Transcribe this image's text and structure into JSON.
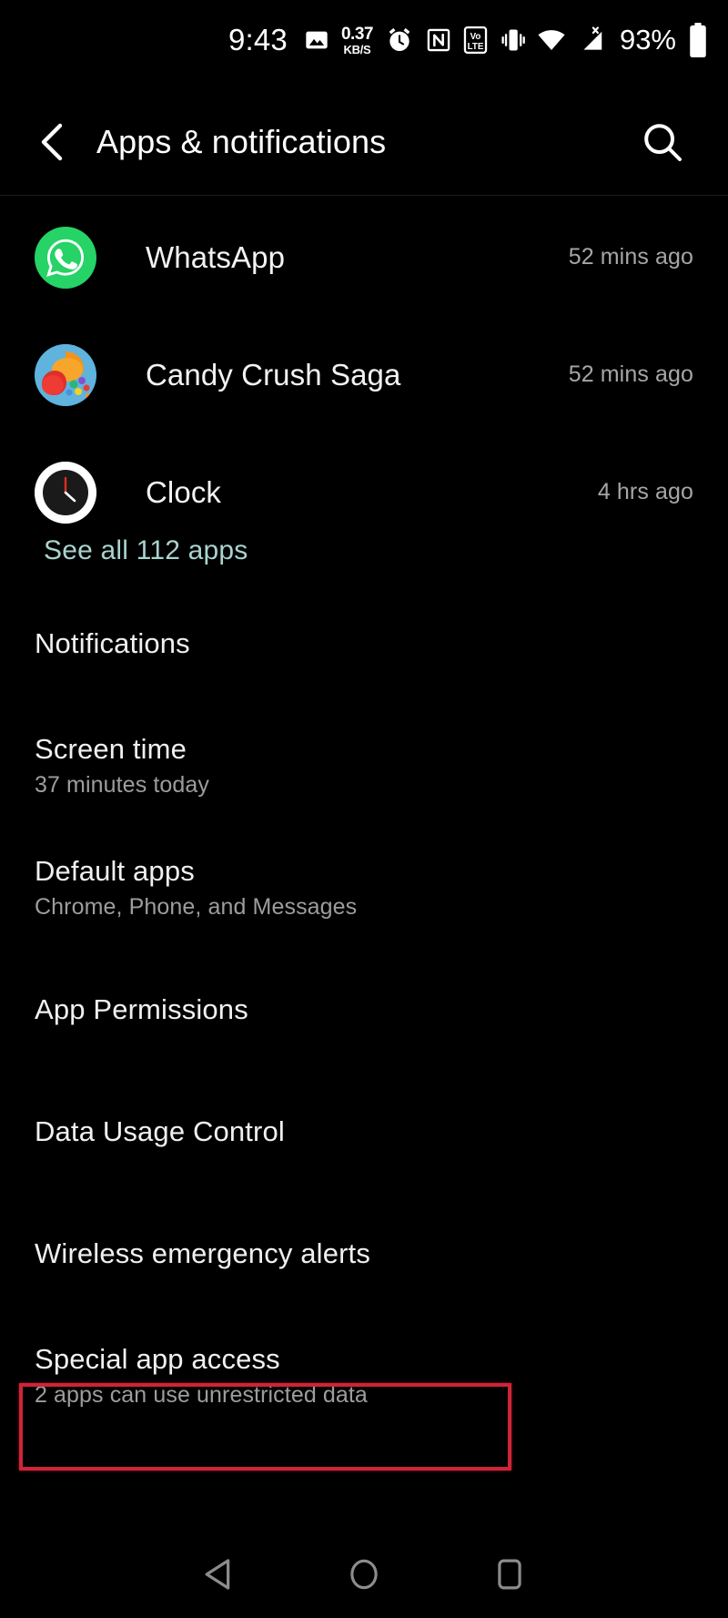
{
  "status_bar": {
    "time": "9:43",
    "icons": [
      {
        "name": "photo-icon",
        "label": "photo"
      },
      {
        "name": "network-speed-indicator",
        "value": "0.37",
        "unit": "KB/S"
      },
      {
        "name": "alarm-icon",
        "label": "alarm"
      },
      {
        "name": "nfc-icon",
        "label": "N"
      },
      {
        "name": "volte-icon",
        "label": "Vo LTE"
      },
      {
        "name": "vibrate-icon",
        "label": "vibrate"
      },
      {
        "name": "wifi-icon",
        "label": "wifi"
      },
      {
        "name": "cellular-signal-icon",
        "label": "no-sim"
      }
    ],
    "battery_percent": "93%"
  },
  "header": {
    "title": "Apps & notifications",
    "back_icon": "chevron-left-icon",
    "search_icon": "search-icon"
  },
  "recent_apps": [
    {
      "name": "WhatsApp",
      "time": "52 mins ago",
      "icon": "whatsapp-icon"
    },
    {
      "name": "Candy Crush Saga",
      "time": "52 mins ago",
      "icon": "candy-crush-icon"
    },
    {
      "name": "Clock",
      "time": "4 hrs ago",
      "icon": "clock-icon"
    }
  ],
  "see_all": {
    "label": "See all 112 apps",
    "color": "#a9d3cd"
  },
  "settings": [
    {
      "title": "Notifications",
      "subtitle": ""
    },
    {
      "title": "Screen time",
      "subtitle": "37 minutes today"
    },
    {
      "title": "Default apps",
      "subtitle": "Chrome, Phone, and Messages"
    },
    {
      "title": "App Permissions",
      "subtitle": ""
    },
    {
      "title": "Data Usage Control",
      "subtitle": ""
    },
    {
      "title": "Wireless emergency alerts",
      "subtitle": ""
    },
    {
      "title": "Special app access",
      "subtitle": "2 apps can use unrestricted data"
    }
  ],
  "highlight": {
    "target": "Special app access",
    "color": "#cf2438"
  },
  "nav_bar": {
    "back": "back-triangle-icon",
    "home": "home-circle-icon",
    "recents": "recents-square-icon"
  }
}
